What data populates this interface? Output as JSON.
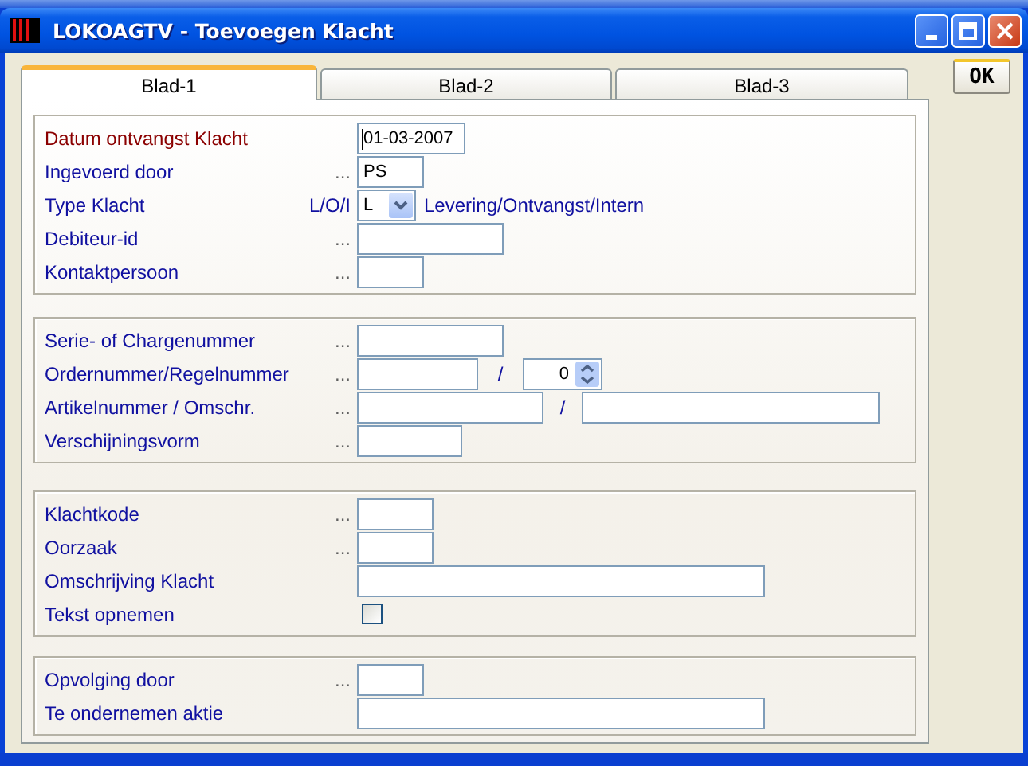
{
  "window": {
    "title": "LOKOAGTV - Toevoegen Klacht"
  },
  "tabs": [
    {
      "label": "Blad-1",
      "selected": true
    },
    {
      "label": "Blad-2",
      "selected": false
    },
    {
      "label": "Blad-3",
      "selected": false
    }
  ],
  "ok_button": "OK",
  "groups": [
    {
      "rows": [
        {
          "label": "Datum ontvangst Klacht",
          "highlighted": true,
          "fields": [
            {
              "kind": "text",
              "value": "01-03-2007",
              "focused": true
            }
          ]
        },
        {
          "label": "Ingevoerd door",
          "highlighted": false,
          "hint": "...",
          "fields": [
            {
              "kind": "text",
              "value": "PS",
              "focused": false
            }
          ]
        },
        {
          "label": "Type Klacht",
          "highlighted": false,
          "hint": "L/O/I",
          "fields": [
            {
              "kind": "select",
              "value": "L"
            },
            {
              "kind": "note",
              "text": "Levering/Ontvangst/Intern"
            }
          ]
        },
        {
          "label": "Debiteur-id",
          "highlighted": false,
          "hint": "...",
          "fields": [
            {
              "kind": "text",
              "focused": false
            }
          ]
        },
        {
          "label": "Kontaktpersoon",
          "highlighted": false,
          "hint": "...",
          "fields": [
            {
              "kind": "text",
              "focused": false
            }
          ]
        }
      ]
    },
    {
      "rows": [
        {
          "label": "Serie- of Chargenummer",
          "highlighted": false,
          "hint": "...",
          "fields": [
            {
              "kind": "text",
              "focused": false
            }
          ]
        },
        {
          "label": "Ordernummer/Regelnummer",
          "highlighted": false,
          "hint": "...",
          "fields": [
            {
              "kind": "text",
              "focused": false
            },
            {
              "kind": "separator",
              "text": "/"
            },
            {
              "kind": "spin",
              "value": "0"
            }
          ]
        },
        {
          "label": "Artikelnummer / Omschr.",
          "highlighted": false,
          "hint": "...",
          "fields": [
            {
              "kind": "text",
              "focused": false
            },
            {
              "kind": "separator",
              "text": "/"
            },
            {
              "kind": "text",
              "focused": false
            }
          ]
        },
        {
          "label": "Verschijningsvorm",
          "highlighted": false,
          "hint": "...",
          "fields": [
            {
              "kind": "text",
              "focused": false
            }
          ]
        }
      ]
    },
    {
      "rows": [
        {
          "label": "Klachtkode",
          "highlighted": false,
          "hint": "...",
          "fields": [
            {
              "kind": "text",
              "focused": false
            }
          ]
        },
        {
          "label": "Oorzaak",
          "highlighted": false,
          "hint": "...",
          "fields": [
            {
              "kind": "text",
              "focused": false
            }
          ]
        },
        {
          "label": "Omschrijving Klacht",
          "highlighted": false,
          "fields": [
            {
              "kind": "text",
              "focused": false
            }
          ]
        },
        {
          "label": "Tekst opnemen",
          "highlighted": false,
          "fields": [
            {
              "kind": "checkbox",
              "checked": false
            }
          ]
        }
      ]
    },
    {
      "rows": [
        {
          "label": "Opvolging door",
          "highlighted": false,
          "hint": "...",
          "fields": [
            {
              "kind": "text",
              "focused": false
            }
          ]
        },
        {
          "label": "Te ondernemen aktie",
          "highlighted": false,
          "fields": [
            {
              "kind": "text",
              "focused": false
            }
          ]
        }
      ]
    }
  ]
}
